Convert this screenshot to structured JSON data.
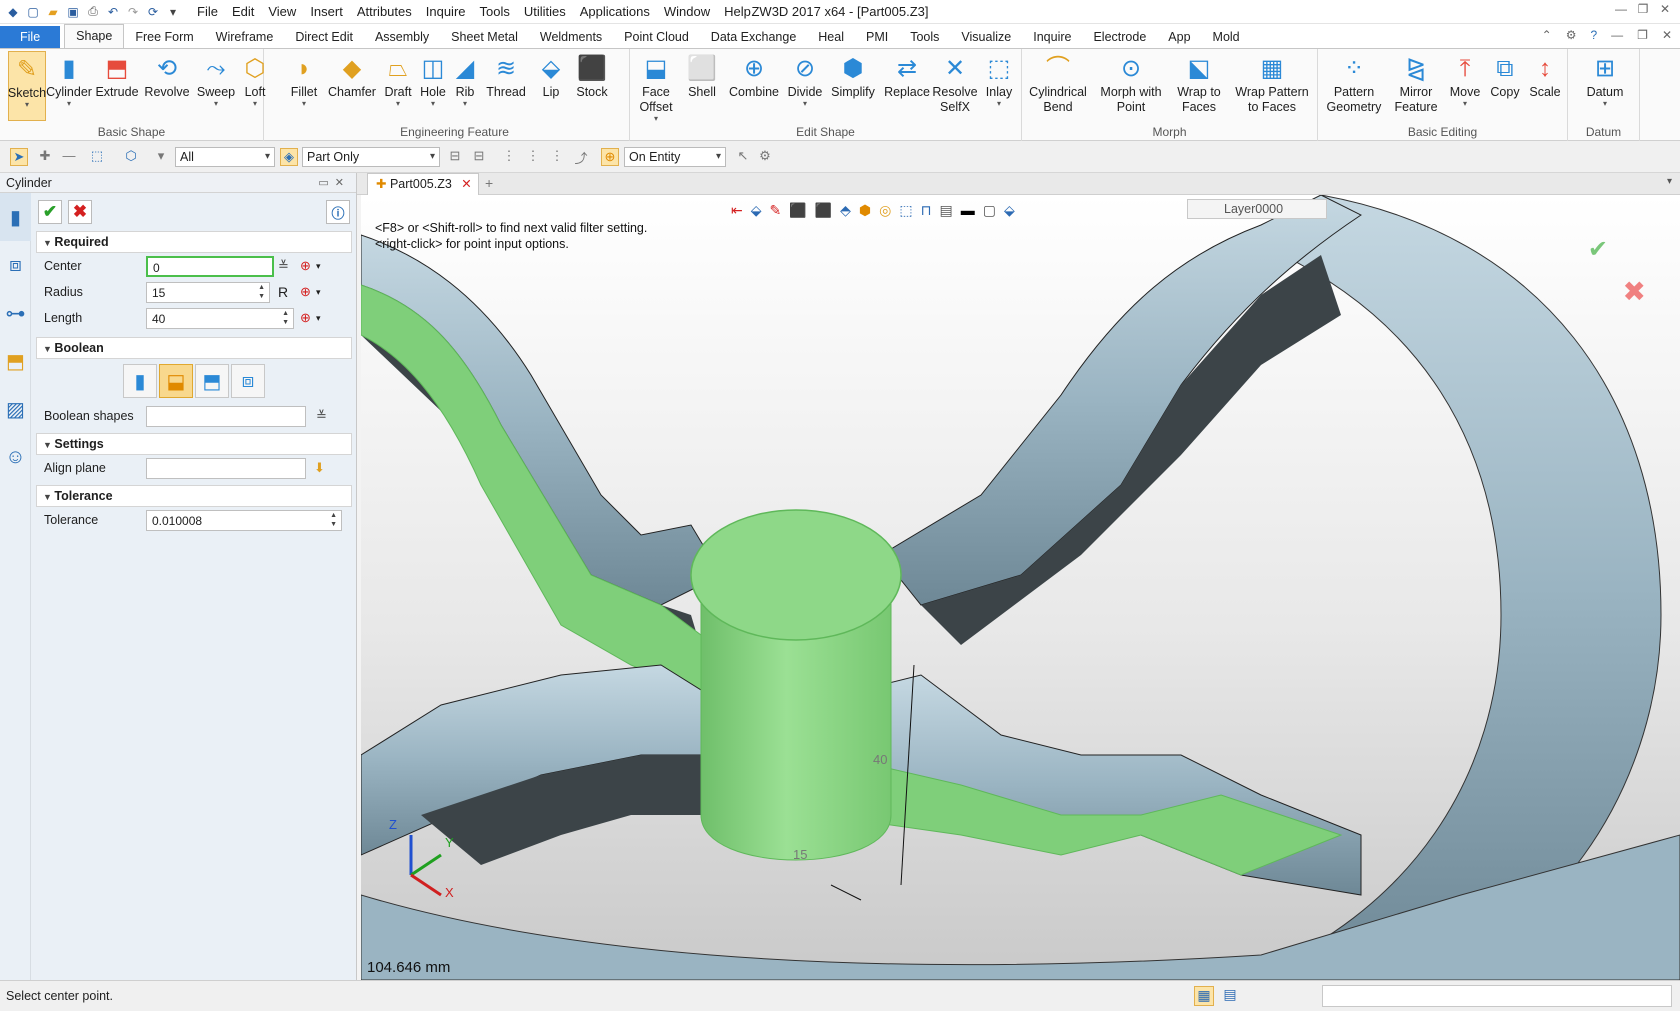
{
  "window": {
    "title": "ZW3D 2017  x64 - [Part005.Z3]"
  },
  "menu": [
    "File",
    "Edit",
    "View",
    "Insert",
    "Attributes",
    "Inquire",
    "Tools",
    "Utilities",
    "Applications",
    "Window",
    "Help"
  ],
  "tabs": [
    "File",
    "Shape",
    "Free Form",
    "Wireframe",
    "Direct Edit",
    "Assembly",
    "Sheet Metal",
    "Weldments",
    "Point Cloud",
    "Data Exchange",
    "Heal",
    "PMI",
    "Tools",
    "Visualize",
    "Inquire",
    "Electrode",
    "App",
    "Mold"
  ],
  "ribbon": {
    "basic_shape": {
      "label": "Basic Shape",
      "buttons": [
        "Sketch",
        "Cylinder",
        "Extrude",
        "Revolve",
        "Sweep",
        "Loft"
      ]
    },
    "engineering": {
      "label": "Engineering Feature",
      "buttons": [
        "Fillet",
        "Chamfer",
        "Draft",
        "Hole",
        "Rib",
        "Thread",
        "Lip",
        "Stock"
      ]
    },
    "edit_shape": {
      "label": "Edit Shape",
      "buttons": [
        "Face Offset",
        "Shell",
        "Combine",
        "Divide",
        "Simplify",
        "Replace",
        "Resolve SelfX",
        "Inlay"
      ]
    },
    "morph": {
      "label": "Morph",
      "buttons": [
        "Cylindrical Bend",
        "Morph with Point",
        "Wrap to Faces",
        "Wrap Pattern to Faces"
      ]
    },
    "basic_editing": {
      "label": "Basic Editing",
      "buttons": [
        "Pattern Geometry",
        "Mirror Feature",
        "Move",
        "Copy",
        "Scale"
      ]
    },
    "datum": {
      "label": "Datum",
      "buttons": [
        "Datum"
      ]
    }
  },
  "toolbar2": {
    "filter": "All",
    "scope": "Part Only",
    "pick": "On Entity"
  },
  "panel": {
    "title": "Cylinder",
    "required": {
      "label": "Required",
      "center_label": "Center",
      "center": "0",
      "radius_label": "Radius",
      "radius": "15",
      "radius_suffix": "R",
      "length_label": "Length",
      "length": "40"
    },
    "boolean": {
      "label": "Boolean",
      "shapes_label": "Boolean shapes"
    },
    "settings": {
      "label": "Settings",
      "align_label": "Align plane"
    },
    "tolerance": {
      "label": "Tolerance",
      "tol_label": "Tolerance",
      "tol": "0.010008"
    }
  },
  "doc_tab": "Part005.Z3",
  "viewport": {
    "hint1": "<F8> or <Shift-roll> to find next valid filter setting.",
    "hint2": "<right-click> for point input options.",
    "layer": "Layer0000",
    "measure": "104.646 mm",
    "dim_length": "40",
    "dim_radius": "15",
    "axes": [
      "X",
      "Y",
      "Z"
    ]
  },
  "status": {
    "text": "Select center point."
  },
  "colors": {
    "accent": "#2b7ad6",
    "green_face": "#8ed888",
    "part_body": "#9ab4c2",
    "shadow": "#3c4448"
  }
}
